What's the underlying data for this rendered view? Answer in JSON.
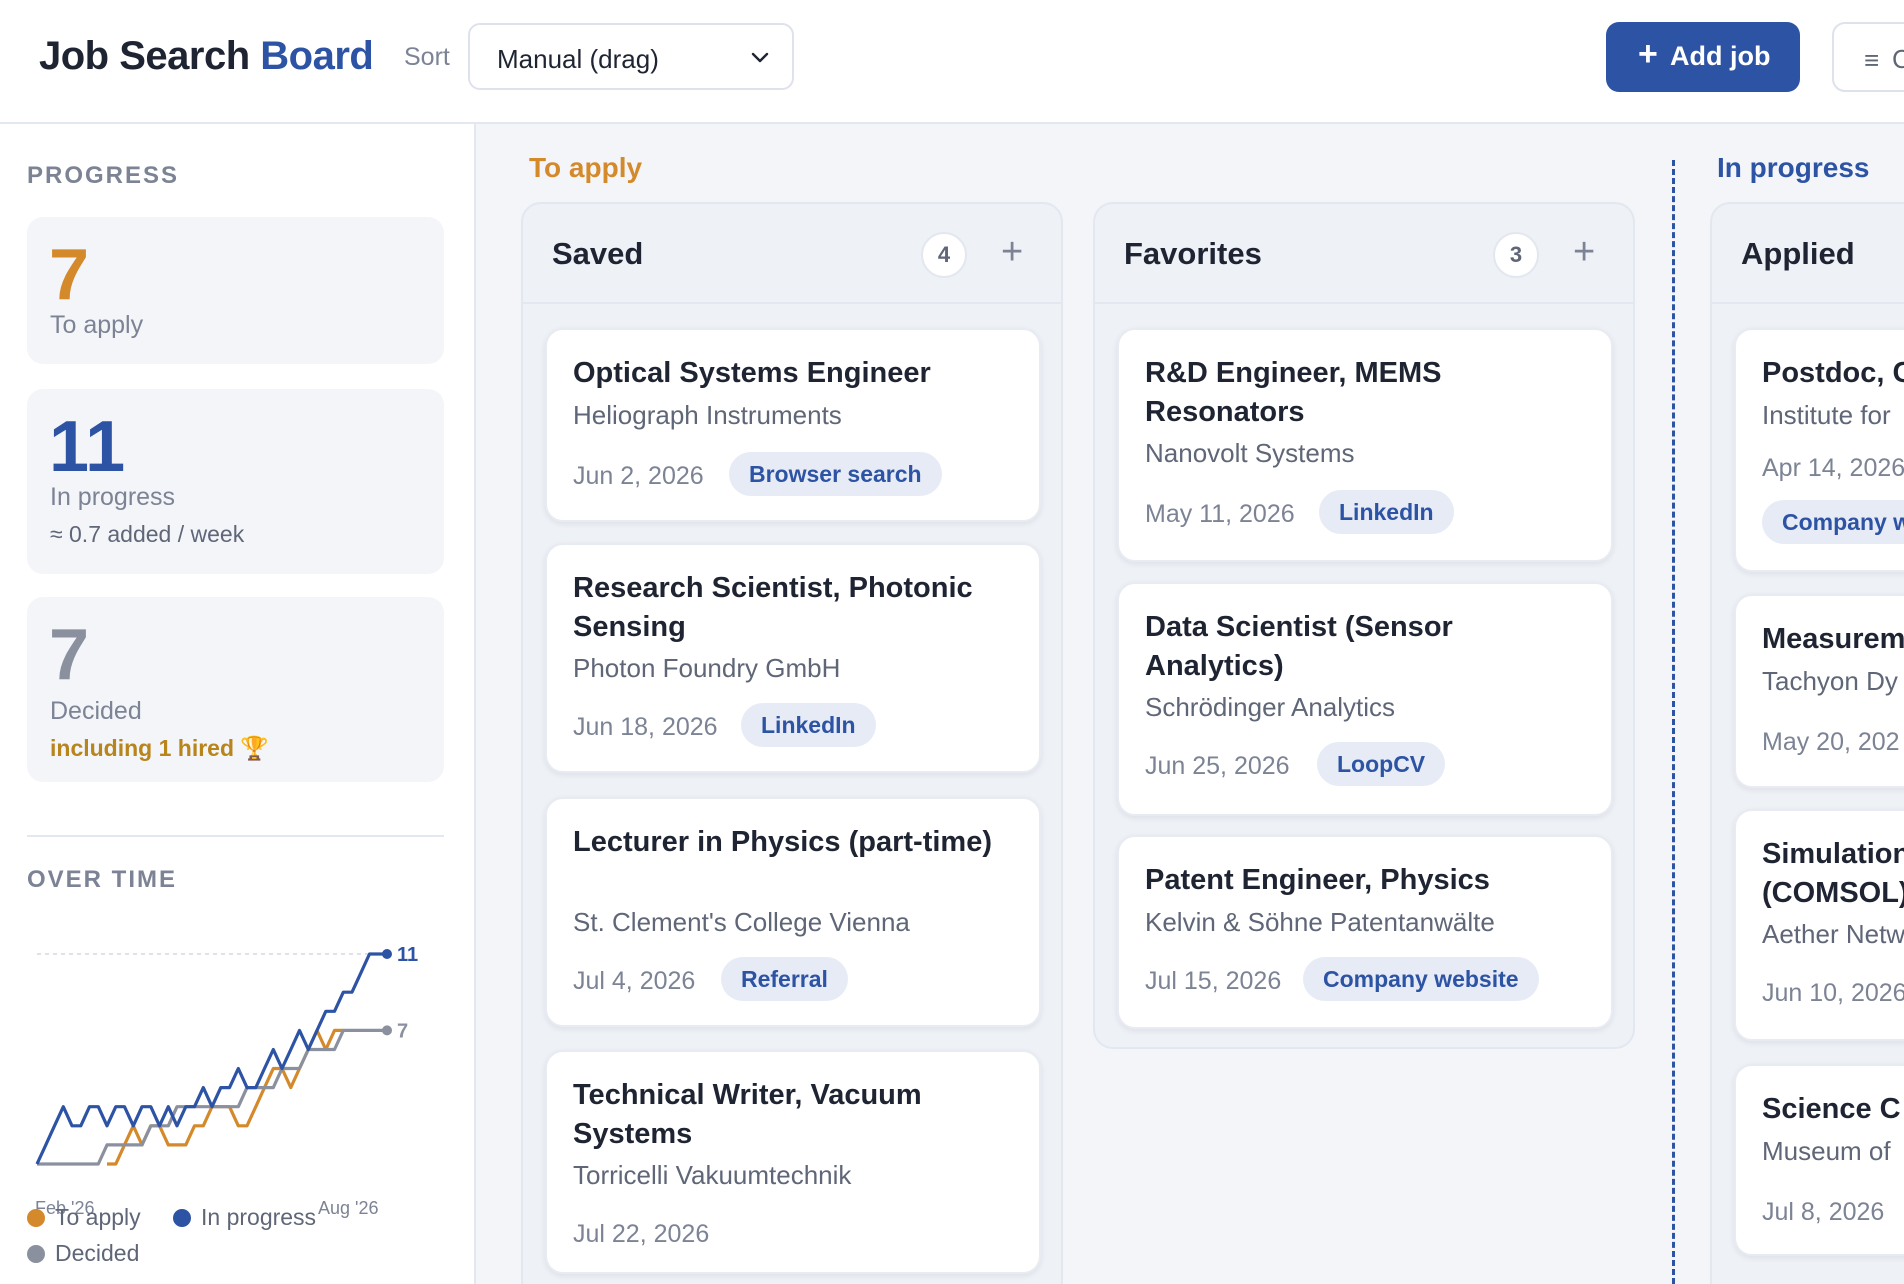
{
  "header": {
    "logo_part1": "Job Search",
    "logo_part2": "Board",
    "sort_label": "Sort",
    "sort_value": "Manual (drag)",
    "add_plus": "+",
    "add_label": "Add job",
    "menu_icon": "≡",
    "menu_label": "C"
  },
  "sidebar": {
    "progress_heading": "PROGRESS",
    "stats": [
      {
        "value": "7",
        "label": "To apply",
        "color": "#d4892a"
      },
      {
        "value": "11",
        "label": "In progress",
        "sub": "≈ 0.7 added / week",
        "color": "#2d53a4"
      },
      {
        "value": "7",
        "label": "Decided",
        "sub": "including 1 hired 🏆",
        "color": "#8a909e"
      }
    ],
    "over_time_heading": "OVER TIME",
    "legend": {
      "to_apply": "To apply",
      "in_progress": "In progress",
      "decided": "Decided"
    }
  },
  "chart_data": {
    "type": "line",
    "x_labels": [
      "Feb '26",
      "Aug '26"
    ],
    "ylim": [
      0,
      11
    ],
    "series": [
      {
        "name": "In progress",
        "color": "#2d53a4",
        "end_label": "11",
        "values": [
          0,
          1,
          2,
          3,
          2,
          2,
          3,
          3,
          2,
          3,
          3,
          2,
          3,
          3,
          2,
          3,
          2,
          3,
          3,
          4,
          3,
          4,
          4,
          5,
          4,
          4,
          5,
          6,
          5,
          6,
          7,
          6,
          7,
          8,
          8,
          9,
          9,
          10,
          11,
          11,
          11
        ]
      },
      {
        "name": "Decided",
        "color": "#8a909e",
        "end_label": "7",
        "values": [
          0,
          0,
          0,
          0,
          0,
          0,
          0,
          0,
          1,
          1,
          1,
          1,
          1,
          2,
          2,
          2,
          3,
          3,
          3,
          3,
          3,
          3,
          3,
          3,
          4,
          4,
          4,
          4,
          5,
          5,
          5,
          6,
          6,
          6,
          6,
          7,
          7,
          7,
          7,
          7,
          7
        ]
      },
      {
        "name": "To apply",
        "color": "#d4892a",
        "end_label": "",
        "values": [
          null,
          null,
          null,
          null,
          null,
          null,
          null,
          null,
          0,
          0,
          1,
          2,
          1,
          2,
          2,
          1,
          1,
          1,
          2,
          2,
          3,
          3,
          3,
          2,
          2,
          3,
          4,
          5,
          5,
          4,
          5,
          6,
          7,
          6,
          7,
          7
        ]
      }
    ]
  },
  "board": {
    "groups": [
      {
        "title": "To apply",
        "color": "#d4892a"
      },
      {
        "title": "In progress",
        "color": "#2d53a4"
      }
    ],
    "columns": [
      {
        "title": "Saved",
        "count": "4",
        "add": "+",
        "cards": [
          {
            "title": "Optical Systems Engineer",
            "company": "Heliograph Instruments",
            "date": "Jun 2, 2026",
            "tag": "Browser search"
          },
          {
            "title": "Research Scientist, Photonic Sensing",
            "company": "Photon Foundry GmbH",
            "date": "Jun 18, 2026",
            "tag": "LinkedIn"
          },
          {
            "title": "Lecturer in Physics (part-time)",
            "company": "St. Clement's College Vienna",
            "date": "Jul 4, 2026",
            "tag": "Referral"
          },
          {
            "title": "Technical Writer, Vacuum Systems",
            "company": "Torricelli Vakuumtechnik",
            "date": "Jul 22, 2026",
            "tag": ""
          }
        ]
      },
      {
        "title": "Favorites",
        "count": "3",
        "add": "+",
        "cards": [
          {
            "title": "R&D Engineer, MEMS Resonators",
            "company": "Nanovolt Systems",
            "date": "May 11, 2026",
            "tag": "LinkedIn"
          },
          {
            "title": "Data Scientist (Sensor Analytics)",
            "company": "Schrödinger Analytics",
            "date": "Jun 25, 2026",
            "tag": "LoopCV"
          },
          {
            "title": "Patent Engineer, Physics",
            "company": "Kelvin & Söhne Patentanwälte",
            "date": "Jul 15, 2026",
            "tag": "Company website"
          }
        ]
      },
      {
        "title": "Applied",
        "cards": [
          {
            "title": "Postdoc, C",
            "company": "Institute for",
            "date": "Apr 14, 2026",
            "tag": "Company w"
          },
          {
            "title": "Measurem",
            "company": "Tachyon Dy",
            "date": "May 20, 202",
            "tag": ""
          },
          {
            "title": "Simulation (COMSOL)",
            "company": "Aether Netw",
            "date": "Jun 10, 2026",
            "tag": ""
          },
          {
            "title": "Science C",
            "company": "Museum of",
            "date": "Jul 8, 2026",
            "tag": ""
          }
        ]
      }
    ]
  }
}
